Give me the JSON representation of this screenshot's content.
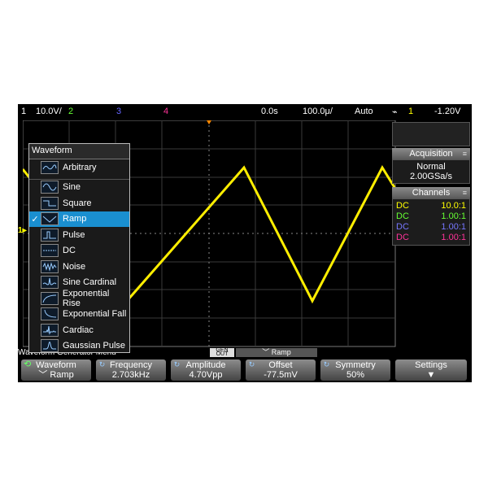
{
  "status": {
    "ch1_num": "1",
    "ch1_scale": "10.0V/",
    "ch2": "2",
    "ch3": "3",
    "ch4": "4",
    "time_delay": "0.0s",
    "time_scale": "100.0μ/",
    "trigger_mode": "Auto",
    "trigger_icon": "trigger-edge-icon",
    "trigger_src": "1",
    "trigger_level": "-1.20V"
  },
  "acquisition": {
    "title": "Acquisition",
    "mode": "Normal",
    "rate": "2.00GSa/s"
  },
  "channels": {
    "title": "Channels",
    "rows": [
      {
        "coupling": "DC",
        "ratio": "10.0:1",
        "color": "#ffff00"
      },
      {
        "coupling": "DC",
        "ratio": "1.00:1",
        "color": "#66ff33"
      },
      {
        "coupling": "DC",
        "ratio": "1.00:1",
        "color": "#6666ff"
      },
      {
        "coupling": "DC",
        "ratio": "1.00:1",
        "color": "#ff3399"
      }
    ]
  },
  "waveform_menu": {
    "title": "Waveform",
    "items": [
      {
        "label": "Arbitrary",
        "icon": "arbitrary-wave-icon"
      },
      {
        "label": "Sine",
        "icon": "sine-wave-icon"
      },
      {
        "label": "Square",
        "icon": "square-wave-icon"
      },
      {
        "label": "Ramp",
        "icon": "ramp-wave-icon",
        "selected": true
      },
      {
        "label": "Pulse",
        "icon": "pulse-wave-icon"
      },
      {
        "label": "DC",
        "icon": "dc-wave-icon"
      },
      {
        "label": "Noise",
        "icon": "noise-wave-icon"
      },
      {
        "label": "Sine Cardinal",
        "icon": "sinc-wave-icon"
      },
      {
        "label": "Exponential Rise",
        "icon": "exp-rise-icon"
      },
      {
        "label": "Exponential Fall",
        "icon": "exp-fall-icon"
      },
      {
        "label": "Cardiac",
        "icon": "cardiac-wave-icon"
      },
      {
        "label": "Gaussian Pulse",
        "icon": "gaussian-pulse-icon"
      }
    ],
    "checkmark": "✓"
  },
  "bottom": {
    "menu_label": "Waveform Generator Menu",
    "gen_tab": "GEN OUT",
    "wave_tab": "Ramp"
  },
  "softkeys": [
    {
      "title": "Waveform",
      "value": "Ramp"
    },
    {
      "title": "Frequency",
      "value": "2.703kHz"
    },
    {
      "title": "Amplitude",
      "value": "4.70Vpp"
    },
    {
      "title": "Offset",
      "value": "-77.5mV"
    },
    {
      "title": "Symmetry",
      "value": "50%"
    },
    {
      "title": "Settings",
      "value": "▼"
    }
  ],
  "colors": {
    "ch1": "#ffff00",
    "ch2": "#66ff33",
    "ch3": "#6666ff",
    "ch4": "#ff3399",
    "accent": "#1a8fd0"
  },
  "ground_marker": "1"
}
